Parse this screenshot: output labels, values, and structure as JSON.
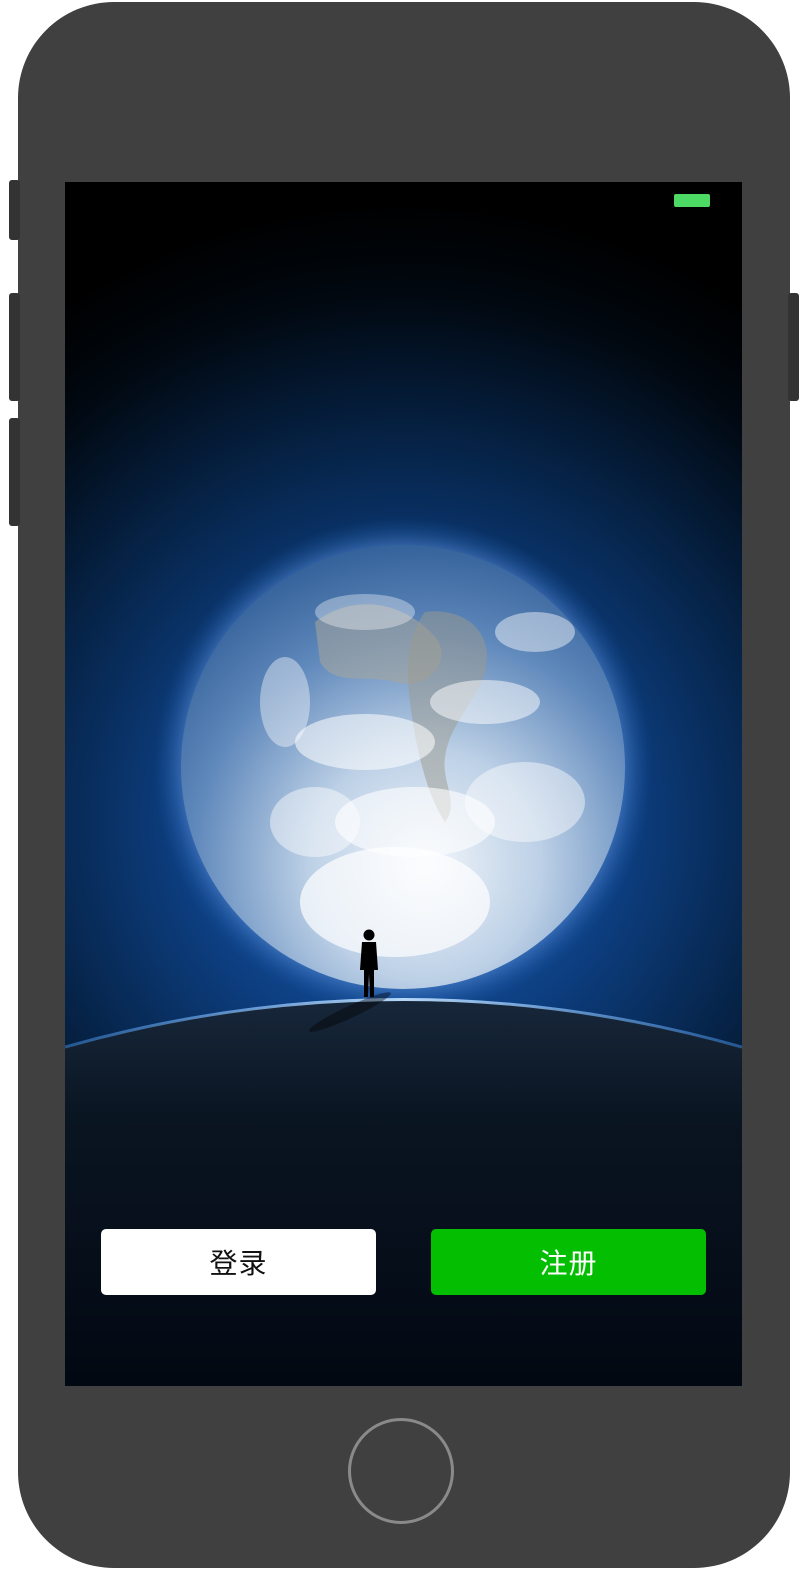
{
  "status_bar": {
    "battery_color": "#4cd964"
  },
  "actions": {
    "login_label": "登录",
    "register_label": "注册",
    "login_bg": "#ffffff",
    "register_bg": "#04be02"
  },
  "device": {
    "frame_color": "#404040",
    "home_button_icon": "home-button"
  },
  "scene": {
    "subject": "earth-icon",
    "figure": "person-silhouette-icon"
  }
}
